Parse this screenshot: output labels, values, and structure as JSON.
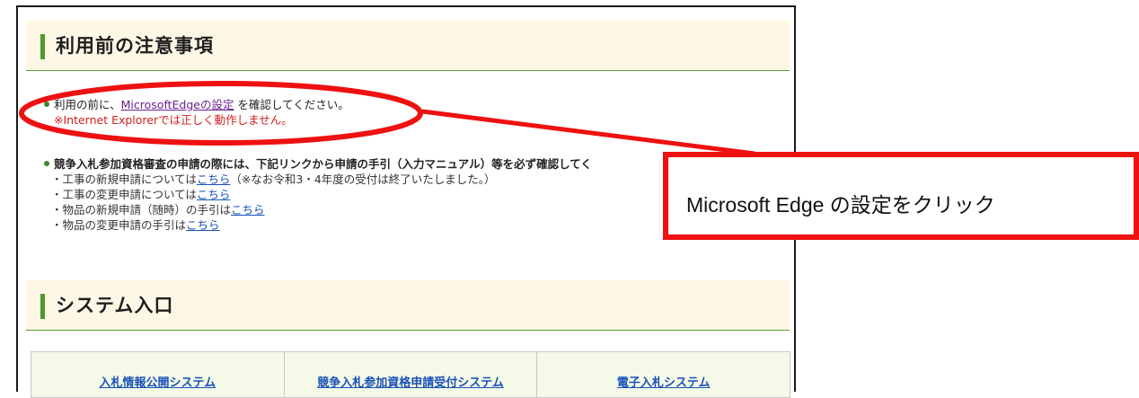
{
  "notice_section": {
    "title": "利用前の注意事項",
    "item1_prefix": "利用の前に、",
    "item1_link": "MicrosoftEdgeの設定",
    "item1_suffix": " を確認してください。",
    "item1_warning": "※Internet Explorerでは正しく動作しません。",
    "item2_text": "競争入札参加資格審査の申請の際には、下記リンクから申請の手引（入力マニュアル）等を必ず確認してく",
    "sub_items": [
      {
        "prefix": "・工事の新規申請については",
        "link": "こちら",
        "suffix": "（※なお令和3・4年度の受付は終了いたしました。）"
      },
      {
        "prefix": "・工事の変更申請については",
        "link": "こちら",
        "suffix": ""
      },
      {
        "prefix": "・物品の新規申請（随時）の手引は",
        "link": "こちら",
        "suffix": ""
      },
      {
        "prefix": "・物品の変更申請の手引は",
        "link": "こちら",
        "suffix": ""
      }
    ]
  },
  "system_section": {
    "title": "システム入口",
    "links": [
      "入札情報公開システム",
      "競争入札参加資格申請受付システム",
      "電子入札システム"
    ]
  },
  "callout": {
    "text": "Microsoft Edge の設定をクリック",
    "color": "#ee1111"
  },
  "colors": {
    "accent_green": "#4e9a2c",
    "header_bg": "#fdf8e6",
    "link_purple": "#6a1f8f",
    "link_blue": "#1a52b8",
    "warning_red": "#d21e1e"
  }
}
